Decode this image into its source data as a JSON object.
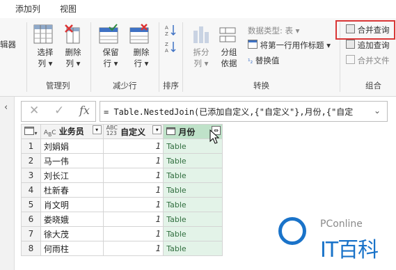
{
  "tabs": [
    "添加列",
    "视图"
  ],
  "ribbon": {
    "cut_label": "辑器",
    "select_cols": "选择\n列 ▾",
    "select_l1": "选择",
    "select_l2": "列",
    "delete_l1": "删除",
    "delete_l2": "列",
    "manage_group": "管理列",
    "keep_l1": "保留",
    "keep_l2": "行",
    "remove_l1": "删除",
    "remove_l2": "行",
    "reduce_group": "减少行",
    "sort_group": "排序",
    "split_l1": "拆分",
    "split_l2": "列",
    "groupby_l1": "分组",
    "groupby_l2": "依据",
    "datatype": "数据类型: 表",
    "first_row": "将第一行用作标题",
    "replace": "替换值",
    "transform_group": "转换",
    "merge_queries": "合并查询",
    "append_queries": "追加查询",
    "merge_files": "合并文件",
    "combine_group": "组合"
  },
  "formula_bar": {
    "formula": "= Table.NestedJoin(已添加自定义,{\"自定义\"},月份,{\"自定"
  },
  "columns": [
    "业务员",
    "自定义",
    "月份"
  ],
  "rows": [
    {
      "n": "1",
      "name": "刘娟娟",
      "val": "1",
      "tbl": "Table"
    },
    {
      "n": "2",
      "name": "马一伟",
      "val": "1",
      "tbl": "Table"
    },
    {
      "n": "3",
      "name": "刘长江",
      "val": "1",
      "tbl": "Table"
    },
    {
      "n": "4",
      "name": "杜新春",
      "val": "1",
      "tbl": "Table"
    },
    {
      "n": "5",
      "name": "肖文明",
      "val": "1",
      "tbl": "Table"
    },
    {
      "n": "6",
      "name": "娄晓娥",
      "val": "1",
      "tbl": "Table"
    },
    {
      "n": "7",
      "name": "徐大茂",
      "val": "1",
      "tbl": "Table"
    },
    {
      "n": "8",
      "name": "何雨柱",
      "val": "1",
      "tbl": "Table"
    }
  ],
  "watermark": {
    "brand": "PConline",
    "site": "IT百科"
  },
  "colors": {
    "accent_green": "#217346",
    "highlight_red": "#d93636"
  }
}
